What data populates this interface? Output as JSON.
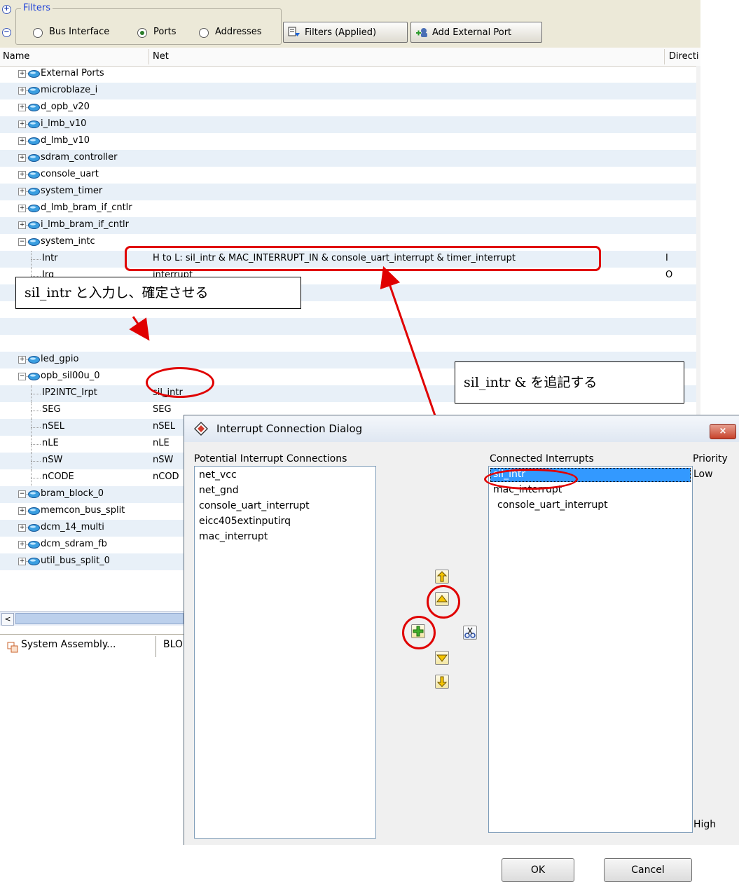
{
  "filters": {
    "legend": "Filters",
    "radios": [
      {
        "label": "Bus Interface",
        "selected": false
      },
      {
        "label": "Ports",
        "selected": true
      },
      {
        "label": "Addresses",
        "selected": false
      }
    ],
    "filters_button": "Filters (Applied)",
    "add_port_button": "Add External Port"
  },
  "columns": {
    "name": "Name",
    "net": "Net",
    "direction": "Directi"
  },
  "tree": {
    "nodes": [
      "External Ports",
      "microblaze_i",
      "d_opb_v20",
      "i_lmb_v10",
      "d_lmb_v10",
      "sdram_controller",
      "console_uart",
      "system_timer",
      "d_lmb_bram_if_cntlr",
      "i_lmb_bram_if_cntlr",
      "system_intc"
    ],
    "system_intc_ports": [
      {
        "name": "Intr",
        "net": "H to L: sil_intr & MAC_INTERRUPT_IN & console_uart_interrupt & timer_interrupt",
        "dir": "I"
      },
      {
        "name": "Irq",
        "net": "interrupt",
        "dir": "O"
      }
    ],
    "led_gpio": "led_gpio",
    "opb_sil00u_0": "opb_sil00u_0",
    "sil_ports": [
      {
        "name": "IP2INTC_Irpt",
        "net": "sil_intr"
      },
      {
        "name": "SEG",
        "net": "SEG"
      },
      {
        "name": "nSEL",
        "net": "nSEL"
      },
      {
        "name": "nLE",
        "net": "nLE"
      },
      {
        "name": "nSW",
        "net": "nSW"
      },
      {
        "name": "nCODE",
        "net": "nCOD"
      }
    ],
    "after_nodes": [
      "bram_block_0",
      "memcon_bus_split",
      "dcm_14_multi",
      "dcm_sdram_fb",
      "util_bus_split_0"
    ]
  },
  "tabs": {
    "system_assembly": "System Assembly...",
    "block": "BLO"
  },
  "annotations": {
    "callout_left": "sil_intr と入力し、確定させる",
    "callout_right": "sil_intr & を追記する"
  },
  "dialog": {
    "title": "Interrupt Connection Dialog",
    "potential_label": "Potential Interrupt Connections",
    "potential_items": [
      "net_vcc",
      "net_gnd",
      "console_uart_interrupt",
      "eicc405extinputirq",
      "mac_interrupt"
    ],
    "connected_label": "Connected Interrupts",
    "connected_items": [
      "sil_intr",
      "mac_interrupt",
      "console_uart_interrupt"
    ],
    "priority_label": "Priority",
    "priority_low": "Low",
    "priority_high": "High",
    "ok": "OK",
    "cancel": "Cancel",
    "close_glyph": "×"
  },
  "colors": {
    "annotation_red": "#e00000",
    "selection_blue": "#3399ff",
    "link_blue": "#1c3fd8"
  }
}
